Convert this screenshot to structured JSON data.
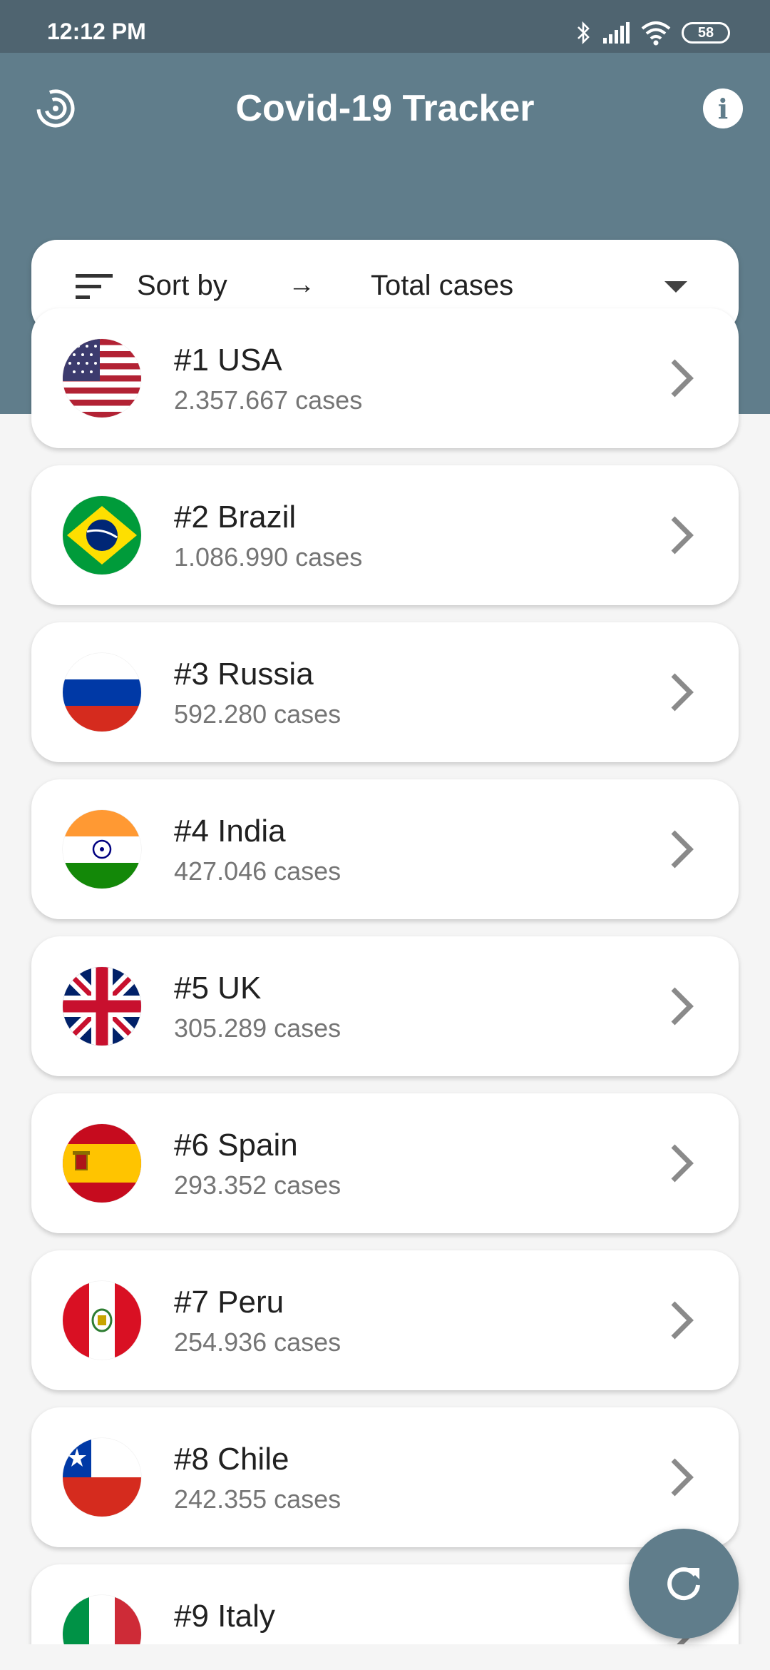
{
  "status_bar": {
    "time": "12:12 PM",
    "battery": "58"
  },
  "header": {
    "title": "Covid-19 Tracker",
    "info_icon": "i"
  },
  "sort": {
    "label": "Sort by",
    "arrow": "→",
    "value": "Total cases"
  },
  "colors": {
    "primary": "#607d8b",
    "status_bar": "#4f6470",
    "background": "#f5f5f5"
  },
  "countries": [
    {
      "rank": "#1",
      "name": "USA",
      "title": "#1 USA",
      "cases": "2.357.667 cases",
      "flag": "usa-flag-icon"
    },
    {
      "rank": "#2",
      "name": "Brazil",
      "title": "#2 Brazil",
      "cases": "1.086.990 cases",
      "flag": "brazil-flag-icon"
    },
    {
      "rank": "#3",
      "name": "Russia",
      "title": "#3 Russia",
      "cases": "592.280 cases",
      "flag": "russia-flag-icon"
    },
    {
      "rank": "#4",
      "name": "India",
      "title": "#4 India",
      "cases": "427.046 cases",
      "flag": "india-flag-icon"
    },
    {
      "rank": "#5",
      "name": "UK",
      "title": "#5 UK",
      "cases": "305.289 cases",
      "flag": "uk-flag-icon"
    },
    {
      "rank": "#6",
      "name": "Spain",
      "title": "#6 Spain",
      "cases": "293.352 cases",
      "flag": "spain-flag-icon"
    },
    {
      "rank": "#7",
      "name": "Peru",
      "title": "#7 Peru",
      "cases": "254.936 cases",
      "flag": "peru-flag-icon"
    },
    {
      "rank": "#8",
      "name": "Chile",
      "title": "#8 Chile",
      "cases": "242.355 cases",
      "flag": "chile-flag-icon"
    },
    {
      "rank": "#9",
      "name": "Italy",
      "title": "#9 Italy",
      "cases": "",
      "flag": "italy-flag-icon"
    }
  ]
}
